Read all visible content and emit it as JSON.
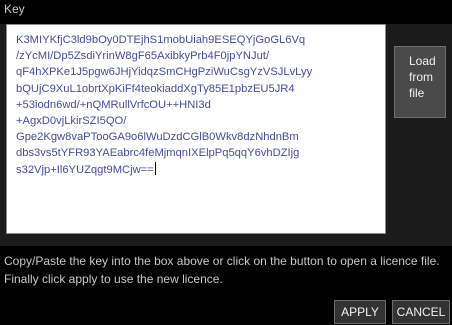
{
  "dialog": {
    "title": "Key",
    "key_lines": [
      "K3MIYKfjC3ld9bOy0DTEjhS1mobUiah9ESEQYjGoGL6Vq",
      "/zYcMI/Dp5ZsdiYrinW8gF65AxibkyPrb4F0jpYNJut/",
      "qF4hXPKe1J5pgw6JHjYidqzSmCHgPziWuCsgYzVSJLvLyy",
      "bQUjC9XuL1obrtXpKiFf4teokiaddXgTy85E1pbzEU5JR4",
      "+53iodn6wd/+nQMRullVrfcOU++HNI3d",
      "+AgxD0vjLkirSZI5QO/",
      "Gpe2Kgw8vaPTooGA9o6lWuDzdCGlB0Wkv8dzNhdnBm",
      "dbs3vs5tYFR93YAEabrc4feMjmqnIXElpPq5qqY6vhDZIjg",
      "s32Vjp+Il6YUZqgt9MCjw=="
    ],
    "load_button": {
      "lines": [
        "Load",
        "from",
        "file"
      ]
    },
    "instructions": "Copy/Paste the key into the box above or click on the button to open a licence file. Finally click apply to use the new licence.",
    "apply_label": "APPLY",
    "cancel_label": "CANCEL"
  },
  "colors": {
    "background": "#000000",
    "panel": "#1c1c1c",
    "key_text": "#4a4a9a",
    "button_bg": "#4a4a4a"
  }
}
